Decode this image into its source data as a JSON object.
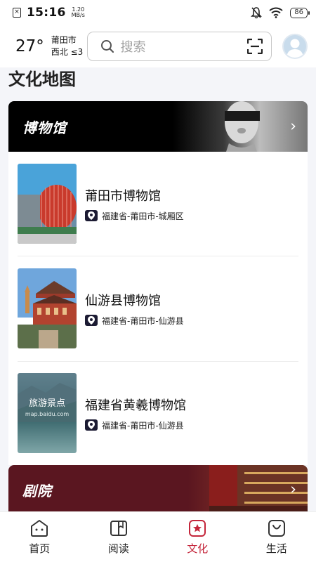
{
  "status_bar": {
    "time": "15:16",
    "net_speed_value": "1.20",
    "net_speed_unit": "MB/s",
    "battery": "86",
    "icons": [
      "sim-off-icon",
      "mute-icon",
      "wifi-icon",
      "battery-icon"
    ]
  },
  "header": {
    "temperature": "27°",
    "city": "莆田市",
    "wind": "西北 ≤3",
    "search_placeholder": "搜索",
    "icons": [
      "search-icon",
      "scan-icon",
      "avatar-icon"
    ]
  },
  "page": {
    "title": "文化地图"
  },
  "museum_section": {
    "title": "博物馆",
    "items": [
      {
        "name": "莆田市博物馆",
        "address": "福建省-莆田市-城厢区"
      },
      {
        "name": "仙游县博物馆",
        "address": "福建省-莆田市-仙游县"
      },
      {
        "name": "福建省黄羲博物馆",
        "address": "福建省-莆田市-仙游县",
        "thumb_text": "旅游景点",
        "thumb_subtext": "map.baidu.com"
      }
    ]
  },
  "theater_section": {
    "title": "剧院"
  },
  "bottom_nav": {
    "items": [
      {
        "label": "首页",
        "icon": "home-icon"
      },
      {
        "label": "阅读",
        "icon": "book-icon"
      },
      {
        "label": "文化",
        "icon": "culture-icon"
      },
      {
        "label": "生活",
        "icon": "life-bag-icon"
      }
    ],
    "active": "文化",
    "active_color": "#c4263b"
  }
}
